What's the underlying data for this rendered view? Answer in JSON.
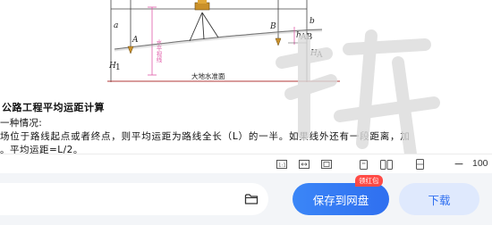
{
  "figure": {
    "label_a": "a",
    "label_h1": "H",
    "label_h1_sub": "1",
    "label_hA": "H",
    "label_hA_sub": "A",
    "label_b": "b",
    "label_hAB": "h",
    "label_hAB_sub": "AB",
    "label_A": "A",
    "label_B": "B",
    "label_side": "水平视线",
    "caption": "大地水准面"
  },
  "document": {
    "heading": "公路工程平均运距计算",
    "line1": "一种情况:",
    "line2": "场位于路线起点或者终点，则平均运距为路线全长（L）的一半。如果线外还有一段距离，加",
    "line3": "。平均运距=L/2。"
  },
  "toolbar": {
    "zoom_value": "100",
    "zoom_out_label": "−"
  },
  "actions": {
    "save_label": "保存到网盘",
    "badge_label": "领红包",
    "download_label": "下载"
  }
}
